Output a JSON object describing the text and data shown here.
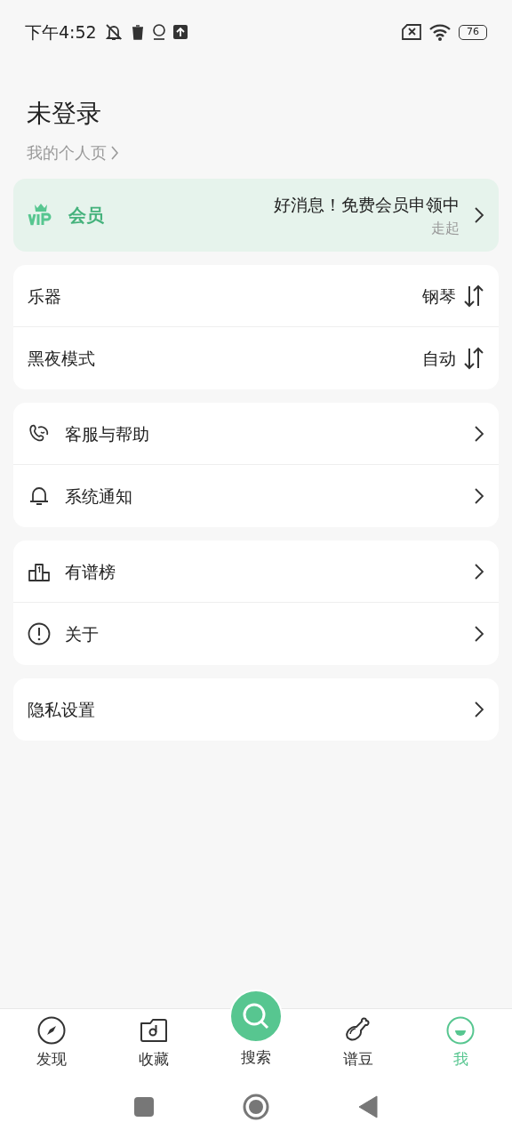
{
  "status_bar": {
    "time": "下午4:52",
    "battery": "76"
  },
  "profile": {
    "name": "未登录",
    "link": "我的个人页"
  },
  "vip": {
    "label": "会员",
    "message": "好消息！免费会员申领中",
    "sub": "走起"
  },
  "groups": [
    {
      "rows": [
        {
          "kind": "select",
          "label": "乐器",
          "value": "钢琴"
        },
        {
          "kind": "select",
          "label": "黑夜模式",
          "value": "自动"
        }
      ]
    },
    {
      "rows": [
        {
          "kind": "icon-link",
          "label": "客服与帮助"
        },
        {
          "kind": "icon-link",
          "label": "系统通知"
        }
      ]
    },
    {
      "rows": [
        {
          "kind": "icon-link",
          "label": "有谱榜"
        },
        {
          "kind": "icon-link",
          "label": "关于"
        }
      ]
    },
    {
      "rows": [
        {
          "kind": "link",
          "label": "隐私设置"
        }
      ]
    }
  ],
  "tabs": [
    {
      "label": "发现",
      "kind": "tab",
      "selected": false
    },
    {
      "label": "收藏",
      "kind": "tab",
      "selected": false
    },
    {
      "label": "搜索",
      "kind": "fab",
      "selected": false
    },
    {
      "label": "谱豆",
      "kind": "tab",
      "selected": false
    },
    {
      "label": "我",
      "kind": "tab",
      "selected": true
    }
  ]
}
